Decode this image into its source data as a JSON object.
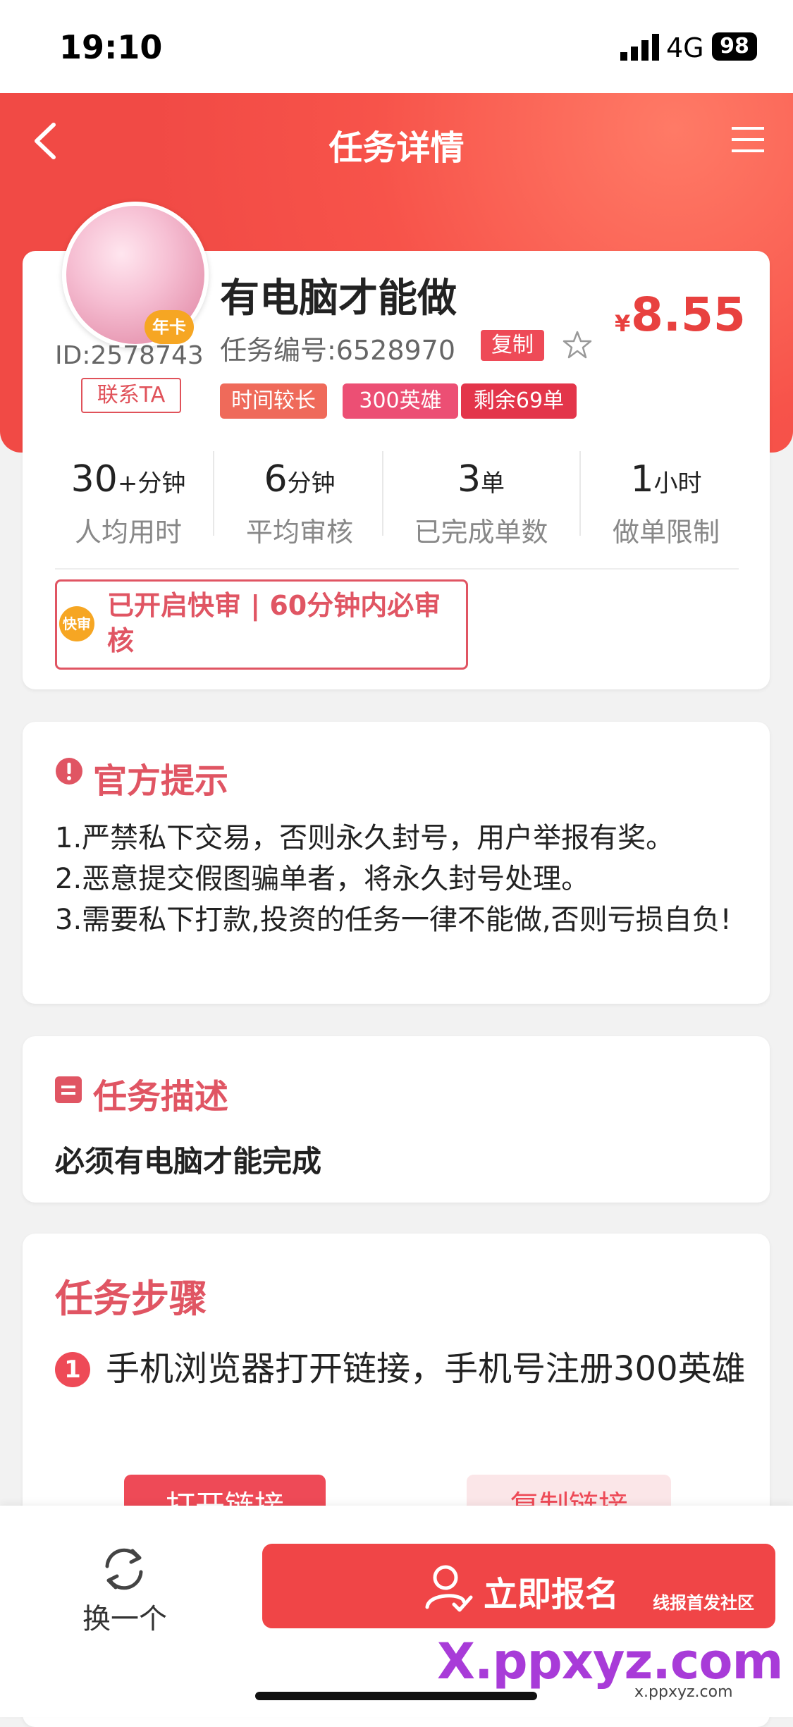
{
  "status_bar": {
    "time": "19:10",
    "network": "4G",
    "battery": "98"
  },
  "header": {
    "title": "任务详情"
  },
  "task": {
    "uid": "ID:2578743",
    "contact_label": "联系TA",
    "avatar_badge": "年卡",
    "title": "有电脑才能做",
    "task_no": "任务编号:6528970",
    "copy_label": "复制",
    "price_symbol": "¥",
    "price": "8.55",
    "tags": [
      "时间较长",
      "300英雄",
      "剩余69单"
    ],
    "stats": [
      {
        "value": "30",
        "unit": "+分钟",
        "label": "人均用时"
      },
      {
        "value": "6",
        "unit": "分钟",
        "label": "平均审核"
      },
      {
        "value": "3",
        "unit": "单",
        "label": "已完成单数"
      },
      {
        "value": "1",
        "unit": "小时",
        "label": "做单限制"
      }
    ],
    "fast_review_icon": "快审",
    "fast_review_text": "已开启快审 | 60分钟内必审核"
  },
  "tips": {
    "title": "官方提示",
    "lines": [
      "1.严禁私下交易，否则永久封号，用户举报有奖。",
      "2.恶意提交假图骗单者，将永久封号处理。",
      "3.需要私下打款,投资的任务一律不能做,否则亏损自负!"
    ]
  },
  "description": {
    "title": "任务描述",
    "body": "必须有电脑才能完成"
  },
  "steps": {
    "title": "任务步骤",
    "items": [
      {
        "num": "1",
        "text": "手机浏览器打开链接，手机号注册300英雄"
      }
    ],
    "open_link_label": "打开链接",
    "copy_link_label": "复制链接"
  },
  "bottom_bar": {
    "swap_label": "换一个",
    "enroll_label": "立即报名"
  },
  "watermark": {
    "line1": "线报首发社区",
    "brand": "X.ppxyz.com",
    "url": "x.ppxyz.com"
  },
  "colors": {
    "brand_red": "#ee4a57",
    "header_red": "#f14a45",
    "price_red": "#e8413f",
    "accent_orange": "#f6a623"
  }
}
